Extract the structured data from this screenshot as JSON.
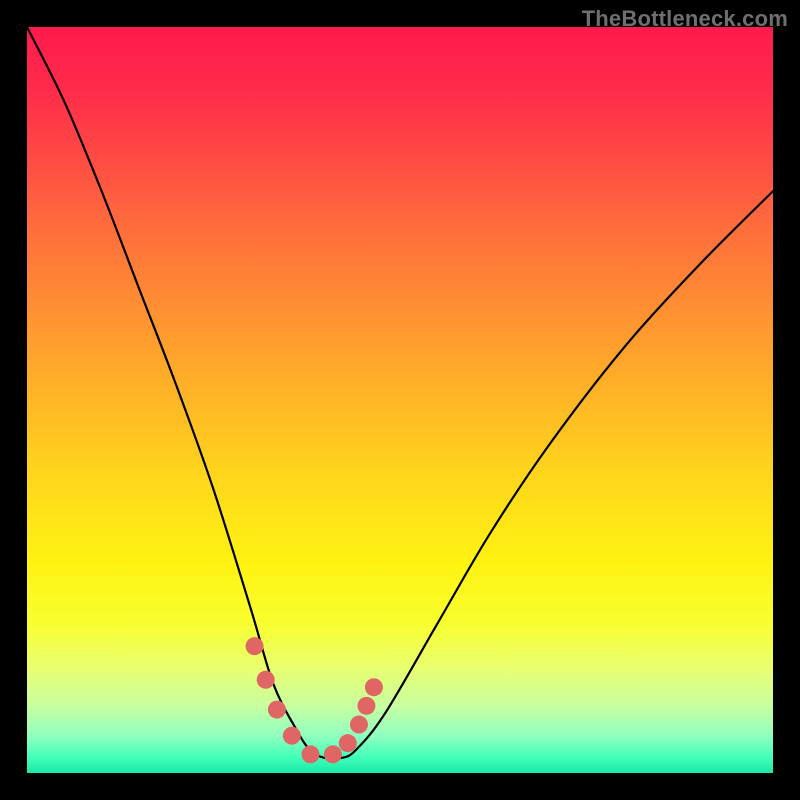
{
  "watermark": "TheBottleneck.com",
  "chart_data": {
    "type": "line",
    "title": "",
    "xlabel": "",
    "ylabel": "",
    "xlim": [
      0,
      100
    ],
    "ylim": [
      0,
      100
    ],
    "series": [
      {
        "name": "bottleneck-curve",
        "x": [
          0,
          5,
          10,
          15,
          20,
          25,
          30,
          33,
          36,
          38,
          40,
          42,
          44,
          48,
          55,
          62,
          70,
          80,
          90,
          100
        ],
        "values": [
          100,
          90,
          78,
          65,
          52,
          38,
          22,
          12,
          6,
          3,
          2,
          2,
          3,
          8,
          20,
          32,
          44,
          57,
          68,
          78
        ]
      }
    ],
    "markers": {
      "name": "highlight-dots",
      "color": "#e06666",
      "x": [
        30.5,
        32.0,
        33.5,
        35.5,
        38.0,
        41.0,
        43.0,
        44.5,
        45.5,
        46.5
      ],
      "values": [
        17.0,
        12.5,
        8.5,
        5.0,
        2.5,
        2.5,
        4.0,
        6.5,
        9.0,
        11.5
      ]
    },
    "gradient_stops": [
      {
        "pos": 0,
        "color": "#ff1a4d"
      },
      {
        "pos": 50,
        "color": "#ffc81e"
      },
      {
        "pos": 80,
        "color": "#f8ff30"
      },
      {
        "pos": 100,
        "color": "#18e8a8"
      }
    ]
  }
}
